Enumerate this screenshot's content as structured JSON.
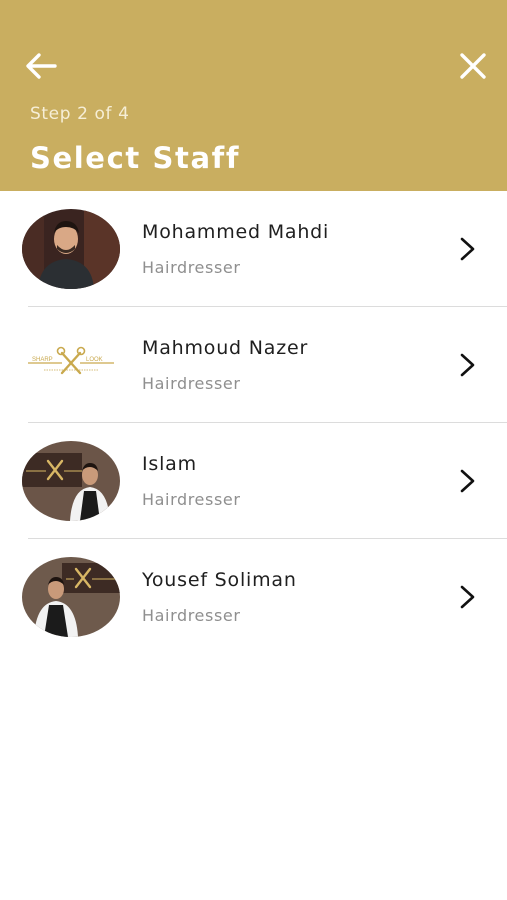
{
  "header": {
    "back_icon": "arrow-left-icon",
    "close_icon": "close-icon",
    "step": "Step 2 of 4",
    "title": "Select Staff",
    "background_color": "#c9ae60"
  },
  "staff": [
    {
      "name": "Mohammed Mahdi",
      "role": "Hairdresser"
    },
    {
      "name": "Mahmoud Nazer",
      "role": "Hairdresser"
    },
    {
      "name": "Islam",
      "role": "Hairdresser"
    },
    {
      "name": "Yousef Soliman",
      "role": "Hairdresser"
    }
  ],
  "logo": {
    "text_left": "SHARP",
    "text_right": "LOOK"
  }
}
